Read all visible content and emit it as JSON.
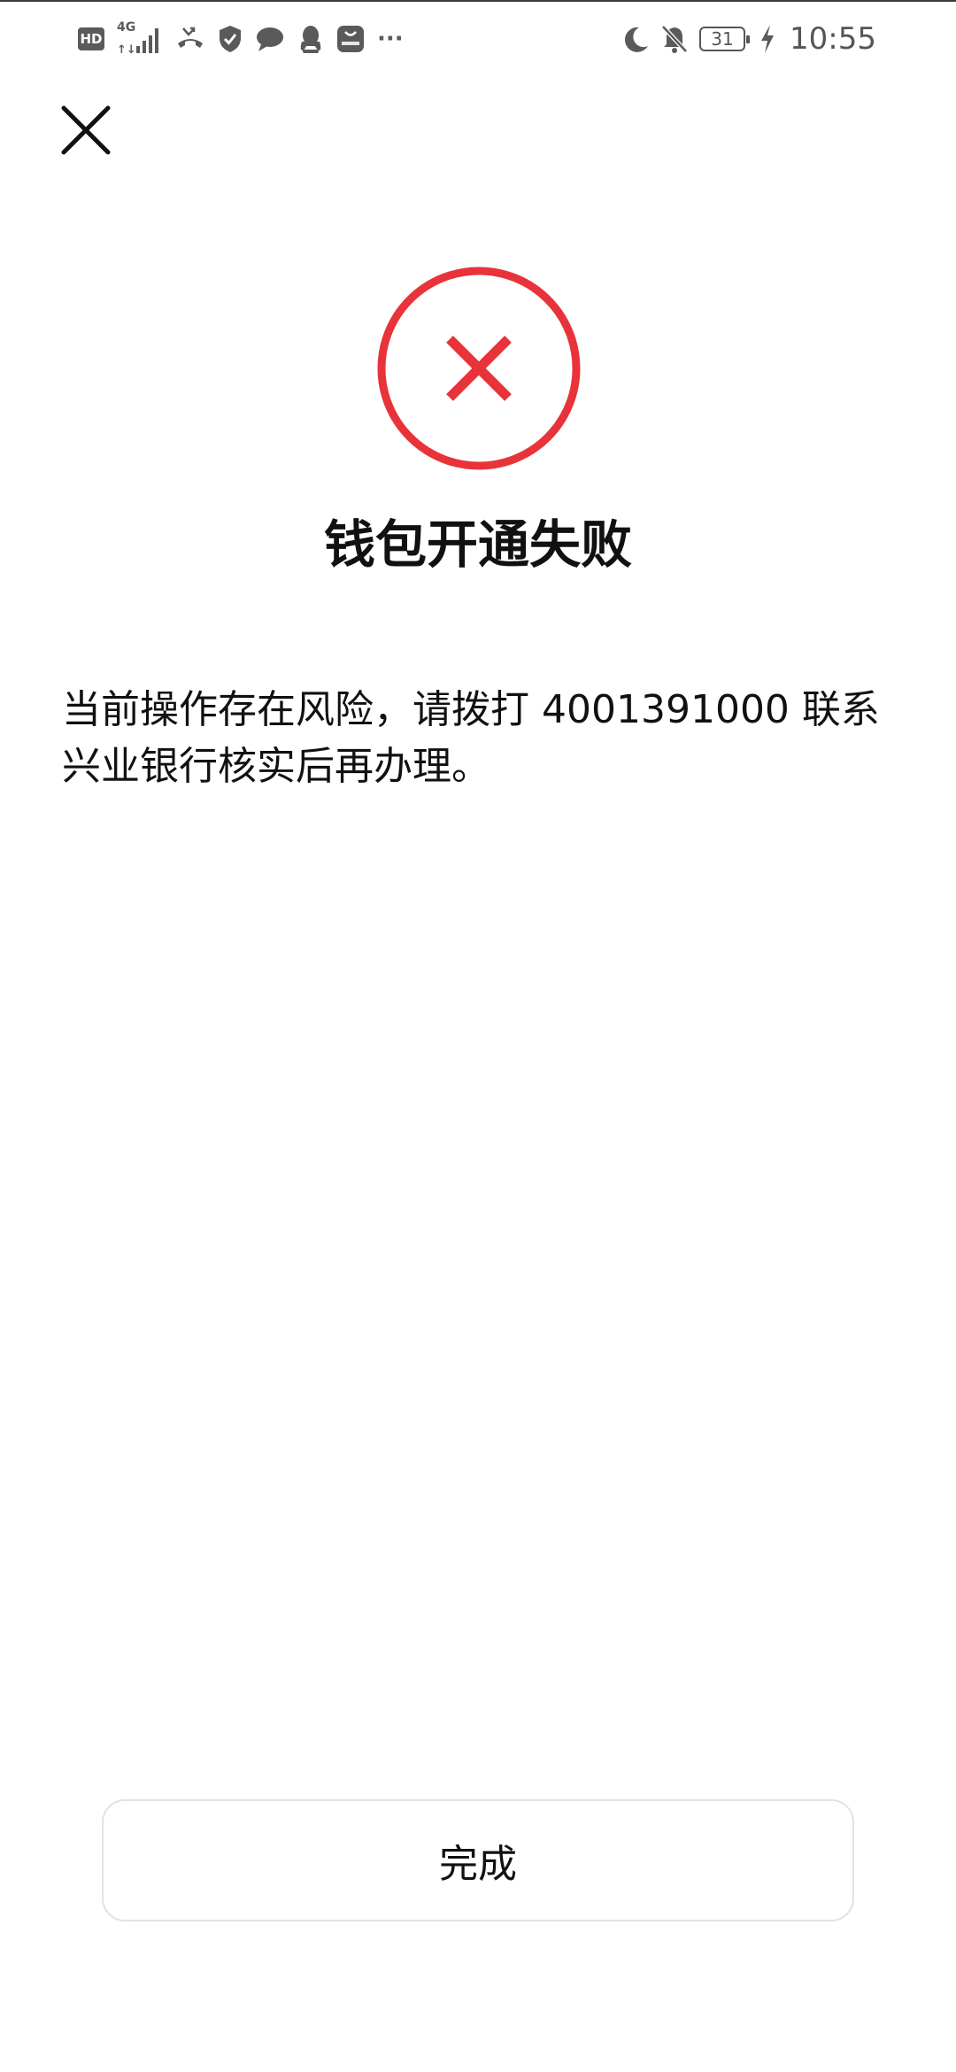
{
  "status_bar": {
    "hd_badge": "HD",
    "network_type": "4G",
    "overflow_indicator": "···",
    "battery_level": "31",
    "time": "10:55",
    "icons": [
      "hd-icon",
      "signal-icon",
      "missed-call-icon",
      "shield-icon",
      "chat-bubble-icon",
      "qq-icon",
      "huawei-store-icon",
      "more-icon",
      "moon-icon",
      "bell-off-icon",
      "battery-icon",
      "charging-icon"
    ]
  },
  "header": {
    "close_icon": "close-icon"
  },
  "result": {
    "status_icon": "error-circle-icon",
    "status_color": "#e8333a",
    "title": "钱包开通失败",
    "description": "当前操作存在风险，请拨打 4001391000 联系兴业银行核实后再办理。"
  },
  "footer": {
    "done_label": "完成"
  }
}
